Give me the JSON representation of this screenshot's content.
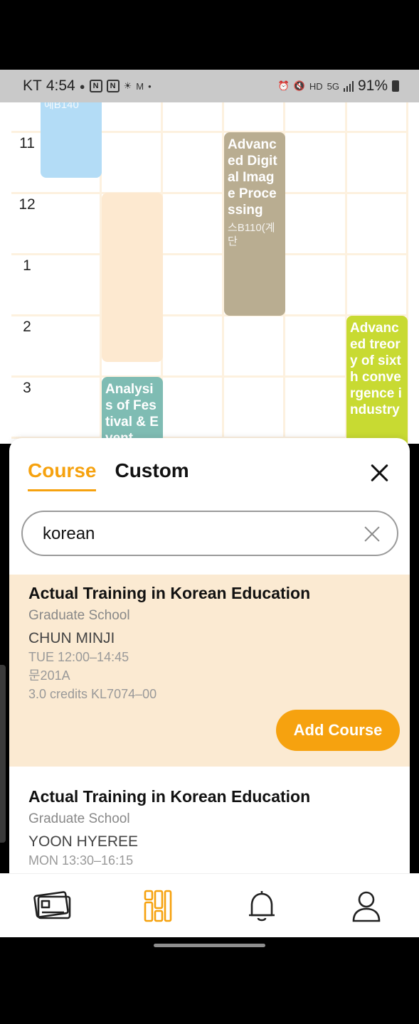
{
  "status_bar": {
    "carrier": "KT",
    "time": "4:54",
    "battery": "91%",
    "icons": [
      "talk-icon",
      "notion-icon",
      "notion-icon",
      "weather-icon",
      "gmail-icon",
      "dot-icon",
      "alarm-icon",
      "mute-icon",
      "hd-icon",
      "5g-icon",
      "signal-icon",
      "battery-icon"
    ]
  },
  "timetable": {
    "hours": [
      "11",
      "12",
      "1",
      "2",
      "3"
    ],
    "blocks": [
      {
        "title": "",
        "room": "예B140",
        "color": "#b3dcf6"
      },
      {
        "title": "",
        "room": "",
        "color": "#fde9d0"
      },
      {
        "title": "Advanced Digital Image Processing",
        "room": "스B110(계단",
        "color": "#b9ad91"
      },
      {
        "title": "Analysis of Festival & Event",
        "room": "",
        "color": "#7fbcb3"
      },
      {
        "title": "Advanced treory of sixth convergence industry",
        "room": "",
        "color": "#c8da32"
      }
    ]
  },
  "sheet": {
    "tabs": [
      {
        "label": "Course",
        "active": true
      },
      {
        "label": "Custom",
        "active": false
      }
    ],
    "search": {
      "value": "korean",
      "placeholder": ""
    },
    "results": [
      {
        "name": "Actual Training in Korean Education",
        "school": "Graduate School",
        "professor": "CHUN MINJI",
        "time": "TUE 12:00–14:45",
        "room": "문201A",
        "credits": "3.0 credits  KL7074–00",
        "button": "Add Course"
      },
      {
        "name": "Actual Training in Korean Education",
        "school": "Graduate School",
        "professor": "YOON HYEREE",
        "time": "MON 13:30–16:15"
      }
    ]
  },
  "nav": {
    "items": [
      "card-icon",
      "timetable-icon",
      "bell-icon",
      "person-icon"
    ],
    "active": "timetable-icon",
    "active_color": "#f6a20f"
  },
  "colors": {
    "accent": "#f6a20f",
    "highlight_bg": "#fbead2"
  }
}
